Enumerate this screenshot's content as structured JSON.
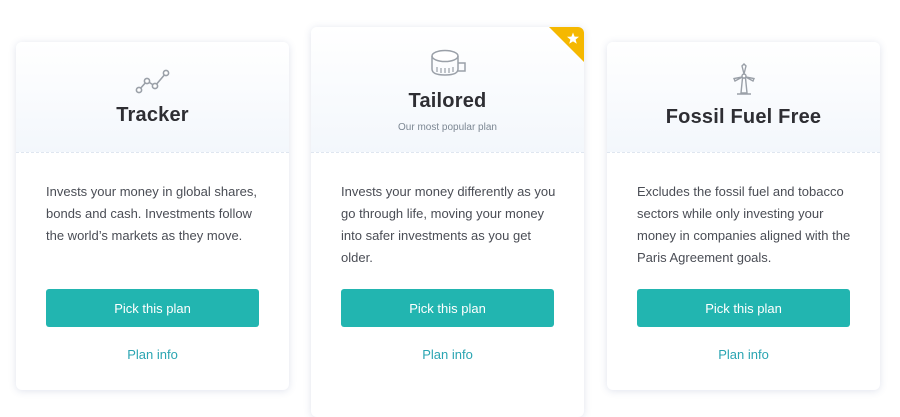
{
  "plans": [
    {
      "icon": "line-chart-icon",
      "title": "Tracker",
      "subtitle": "",
      "description": "Invests your money in global shares, bonds and cash. Investments follow the world’s markets as they move.",
      "button_label": "Pick this plan",
      "link_label": "Plan info"
    },
    {
      "icon": "measuring-tape-icon",
      "title": "Tailored",
      "subtitle": "Our most popular plan",
      "badge_icon": "star-icon",
      "description": "Invests your money differently as you go through life, moving your money into safer investments as you get older.",
      "button_label": "Pick this plan",
      "link_label": "Plan info"
    },
    {
      "icon": "wind-turbine-icon",
      "title": "Fossil Fuel Free",
      "subtitle": "",
      "description": "Excludes the fossil fuel and tobacco sectors while only investing your money in companies aligned with the Paris Agreement goals.",
      "button_label": "Pick this plan",
      "link_label": "Plan info"
    }
  ],
  "colors": {
    "button": "#22b5b0",
    "link": "#2aa5b2",
    "badge": "#f5b800"
  }
}
